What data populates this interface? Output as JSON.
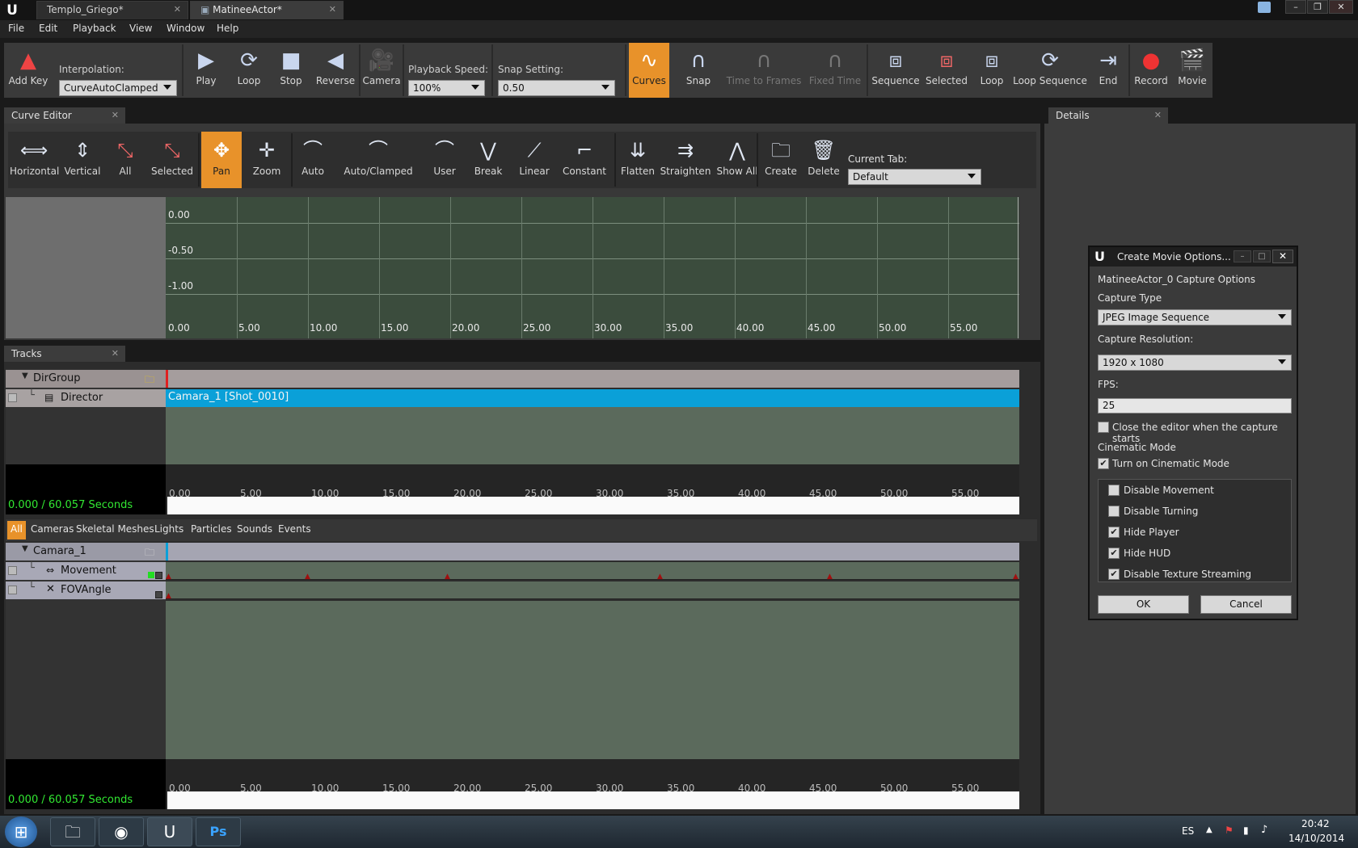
{
  "window": {
    "tabs": [
      {
        "label": "Templo_Griego*",
        "active": false
      },
      {
        "label": "MatineeActor*",
        "active": true
      }
    ],
    "minimize": "–",
    "maximize": "❐",
    "close": "✕"
  },
  "menu": [
    "File",
    "Edit",
    "Playback",
    "View",
    "Window",
    "Help"
  ],
  "toolbar": {
    "add_key": "Add Key",
    "interpolation_label": "Interpolation:",
    "interpolation_value": "CurveAutoClamped",
    "play": "Play",
    "loop": "Loop",
    "stop": "Stop",
    "reverse": "Reverse",
    "camera": "Camera",
    "playback_speed_label": "Playback Speed:",
    "playback_speed_value": "100%",
    "snap_setting_label": "Snap Setting:",
    "snap_setting_value": "0.50",
    "curves": "Curves",
    "snap": "Snap",
    "time_to_frames": "Time to Frames",
    "fixed_time": "Fixed Time",
    "sequence": "Sequence",
    "selected": "Selected",
    "loop2": "Loop",
    "loop_sequence": "Loop Sequence",
    "end": "End",
    "record": "Record",
    "movie": "Movie"
  },
  "curve_editor": {
    "tab": "Curve Editor",
    "buttons": {
      "horizontal": "Horizontal",
      "vertical": "Vertical",
      "all": "All",
      "selected": "Selected",
      "pan": "Pan",
      "zoom": "Zoom",
      "auto": "Auto",
      "auto_clamped": "Auto/Clamped",
      "user": "User",
      "break": "Break",
      "linear": "Linear",
      "constant": "Constant",
      "flatten": "Flatten",
      "straighten": "Straighten",
      "show_all": "Show All",
      "create": "Create",
      "delete": "Delete"
    },
    "current_tab_label": "Current Tab:",
    "current_tab_value": "Default",
    "y_labels": [
      "0.00",
      "-0.50",
      "-1.00",
      "0.00"
    ],
    "x_labels": [
      "5.00",
      "10.00",
      "15.00",
      "20.00",
      "25.00",
      "30.00",
      "35.00",
      "40.00",
      "45.00",
      "50.00",
      "55.00"
    ]
  },
  "details": {
    "tab": "Details"
  },
  "tracks": {
    "tab": "Tracks",
    "dir_group": "DirGroup",
    "director": "Director",
    "director_shot": "Camara_1 [Shot_0010]",
    "ruler_labels": [
      "0.00",
      "5.00",
      "10.00",
      "15.00",
      "20.00",
      "25.00",
      "30.00",
      "35.00",
      "40.00",
      "45.00",
      "50.00",
      "55.00"
    ],
    "time_readout": "0.000 / 60.057 Seconds",
    "filters": [
      "All",
      "Cameras",
      "Skeletal Meshes",
      "Lights",
      "Particles",
      "Sounds",
      "Events"
    ],
    "camera_group": "Camara_1",
    "movement": "Movement",
    "fov_angle": "FOVAngle",
    "time_readout2": "0.000 / 60.057 Seconds"
  },
  "dialog": {
    "title": "Create Movie Options...",
    "capture_options": "MatineeActor_0 Capture Options",
    "capture_type_label": "Capture Type",
    "capture_type_value": "JPEG Image Sequence",
    "capture_resolution_label": "Capture Resolution:",
    "capture_resolution_value": "1920 x 1080",
    "fps_label": "FPS:",
    "fps_value": "25",
    "close_editor": "Close the editor when the capture starts",
    "cinematic_mode_label": "Cinematic Mode",
    "turn_on_cinematic": "Turn on Cinematic Mode",
    "disable_movement": "Disable Movement",
    "disable_turning": "Disable Turning",
    "hide_player": "Hide Player",
    "hide_hud": "Hide HUD",
    "disable_texture_streaming": "Disable Texture Streaming",
    "ok": "OK",
    "cancel": "Cancel"
  },
  "taskbar": {
    "lang": "ES",
    "time": "20:42",
    "date": "14/10/2014"
  }
}
